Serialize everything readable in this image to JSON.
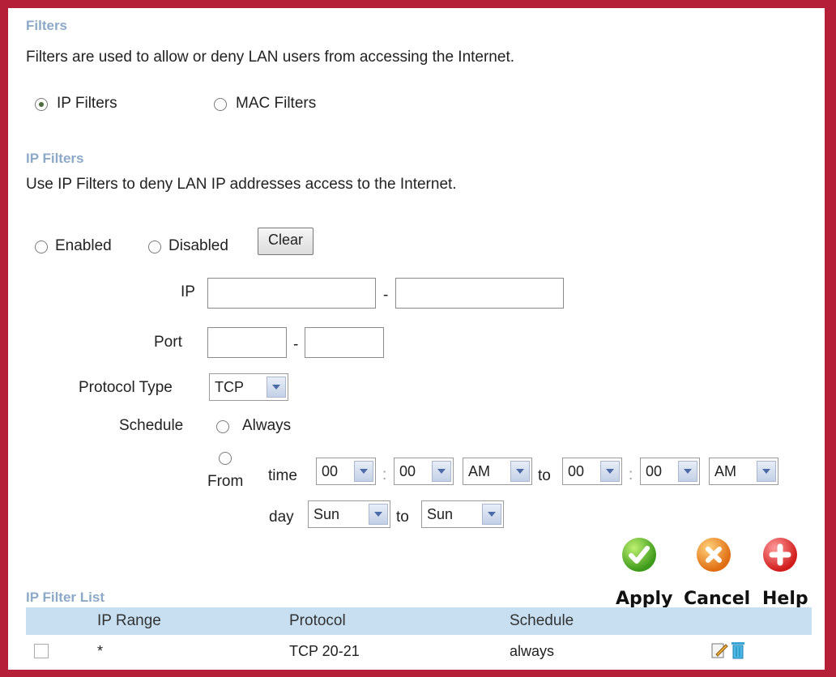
{
  "filters": {
    "title": "Filters",
    "description": "Filters are used to allow or deny LAN users from accessing the Internet.",
    "type_options": [
      {
        "label": "IP Filters",
        "checked": true
      },
      {
        "label": "MAC Filters",
        "checked": false
      }
    ]
  },
  "ip_filters": {
    "title": "IP Filters",
    "description": "Use IP Filters to deny LAN IP addresses access to the Internet.",
    "enabled_label": "Enabled",
    "disabled_label": "Disabled",
    "clear_label": "Clear",
    "ip_label": "IP",
    "port_label": "Port",
    "range_separator": "-",
    "protocol_label": "Protocol Type",
    "protocol_value": "TCP",
    "schedule_label": "Schedule",
    "always_label": "Always",
    "from_label": "From",
    "time_label": "time",
    "to_label": "to",
    "time_separator": ":",
    "time_from_hour": "00",
    "time_from_min": "00",
    "time_from_ampm": "AM",
    "time_to_hour": "00",
    "time_to_min": "00",
    "time_to_ampm": "AM",
    "day_label": "day",
    "day_from": "Sun",
    "day_to": "Sun"
  },
  "actions": {
    "apply": "Apply",
    "cancel": "Cancel",
    "help": "Help"
  },
  "list": {
    "title": "IP Filter List",
    "columns": [
      "IP Range",
      "Protocol",
      "Schedule"
    ],
    "rows": [
      {
        "ip_range": "*",
        "protocol": "TCP 20-21",
        "schedule": "always"
      }
    ]
  }
}
